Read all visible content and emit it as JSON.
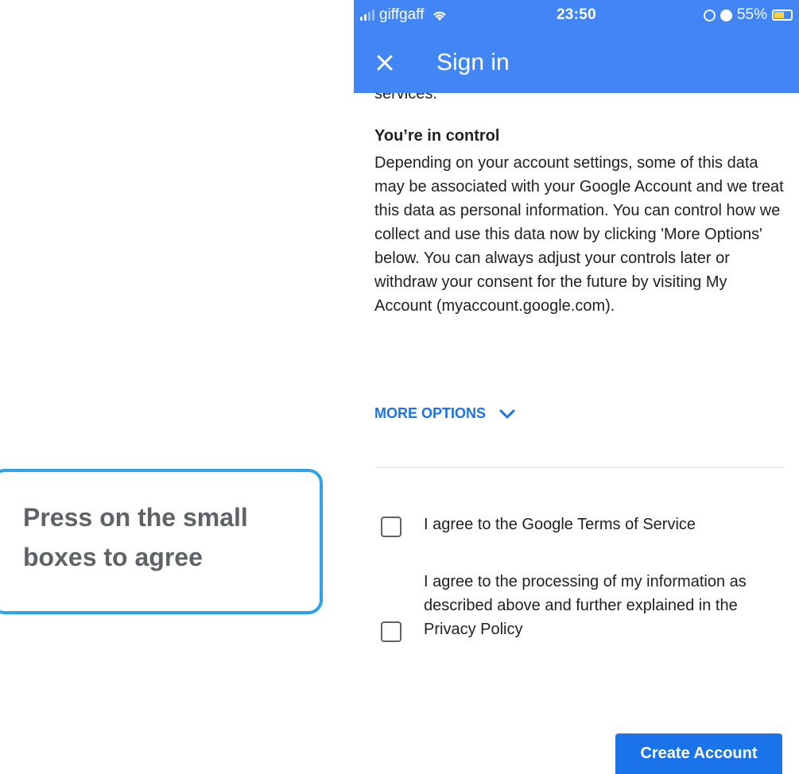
{
  "status_bar": {
    "carrier": "giffgaff",
    "time": "23:50",
    "battery_percent": "55%",
    "icons": [
      "signal-icon",
      "wifi-icon",
      "orientation-lock-icon",
      "alarm-icon",
      "battery-icon"
    ],
    "battery_level": 0.55
  },
  "app_bar": {
    "title": "Sign in",
    "close_icon": "close-icon",
    "color": "#4285f4"
  },
  "content": {
    "cut_text": "services.",
    "heading": "You’re in control",
    "body": "Depending on your account settings, some of this data may be associated with your Google Account and we treat this data as personal information. You can control how we collect and use this data now by clicking 'More Options' below. You can always adjust your controls later or withdraw your consent for the future by visiting My Account (myaccount.google.com).",
    "more_options_label": "MORE OPTIONS",
    "accent_color": "#1a73e8"
  },
  "agreements": [
    {
      "label": "I agree to the Google Terms of Service",
      "checked": false
    },
    {
      "label": "I agree to the processing of my information as described above and further explained in the Privacy Policy",
      "checked": false
    }
  ],
  "actions": {
    "create_account_label": "Create Account"
  },
  "callout": {
    "text": "Press on the small boxes to agree",
    "border_color": "#2ea4e6"
  }
}
